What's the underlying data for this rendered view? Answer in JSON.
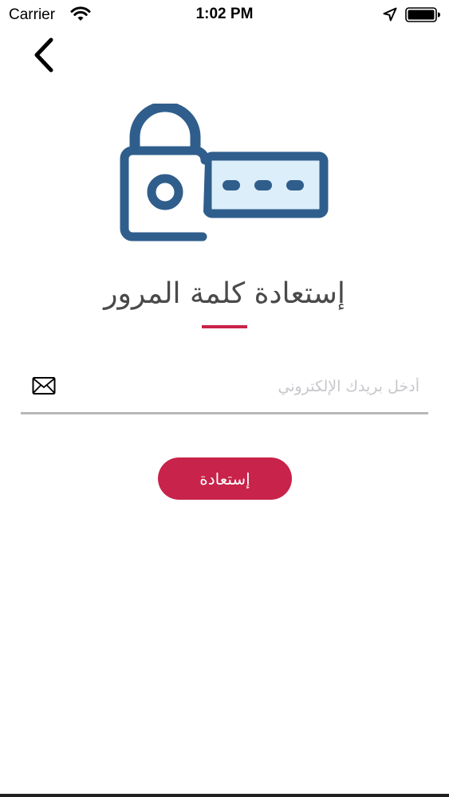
{
  "status_bar": {
    "carrier": "Carrier",
    "time": "1:02 PM"
  },
  "icons": {
    "back": "chevron-left-icon",
    "hero": "lock-password-icon",
    "mail": "envelope-icon",
    "wifi": "wifi-icon",
    "location": "location-arrow-icon",
    "battery": "battery-icon"
  },
  "colors": {
    "accent": "#c8234a",
    "icon_navy": "#2f5e8c",
    "icon_fill": "#dbeefa",
    "title_text": "#4a4a4a",
    "placeholder": "#c7c7cc",
    "underline": "#b8b8b8"
  },
  "page": {
    "title": "إستعادة كلمة المرور"
  },
  "form": {
    "email_value": "",
    "email_placeholder": "أدخل بريدك الإلكتروني",
    "submit_label": "إستعادة"
  }
}
